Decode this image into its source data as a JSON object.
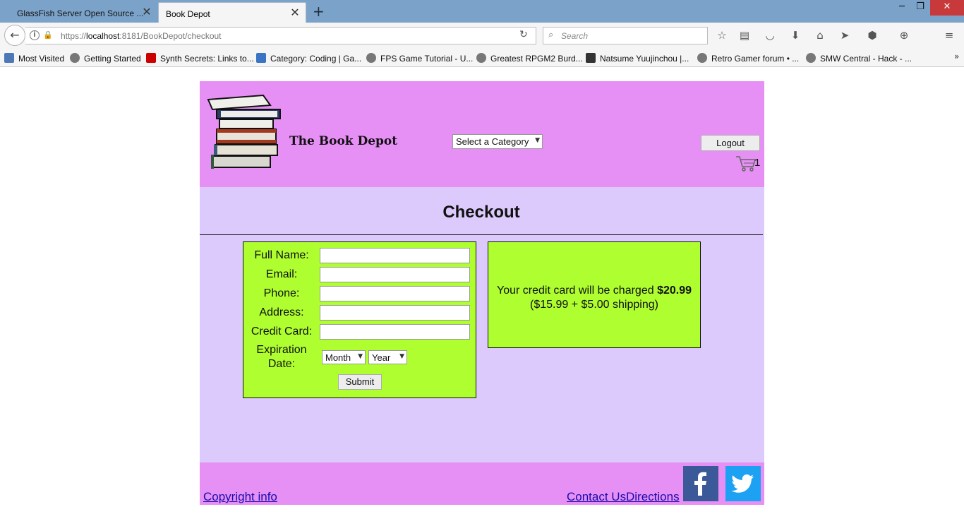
{
  "browser": {
    "tabs": [
      {
        "title": "GlassFish Server Open Source ...",
        "active": false
      },
      {
        "title": "Book Depot",
        "active": true
      }
    ],
    "url": {
      "scheme": "https://",
      "host": "localhost",
      "rest": ":8181/BookDepot/checkout"
    },
    "search_placeholder": "Search",
    "bookmarks": [
      {
        "label": "Most Visited",
        "icon": "bookmark-star-icon"
      },
      {
        "label": "Getting Started",
        "icon": "globe-icon"
      },
      {
        "label": "Synth Secrets: Links to...",
        "icon": "sos-icon"
      },
      {
        "label": "Category: Coding | Ga...",
        "icon": "wix-icon"
      },
      {
        "label": "FPS Game Tutorial - U...",
        "icon": "globe-icon"
      },
      {
        "label": "Greatest RPGM2 Burd...",
        "icon": "globe-icon"
      },
      {
        "label": "Natsume Yuujinchou |...",
        "icon": "ap-icon"
      },
      {
        "label": "Retro Gamer forum • ...",
        "icon": "globe-icon"
      },
      {
        "label": "SMW Central - Hack - ...",
        "icon": "globe-icon"
      }
    ]
  },
  "header": {
    "site_title": "The Book Depot",
    "category_select": "Select a Category",
    "logout_label": "Logout",
    "cart_count": "1"
  },
  "main": {
    "title": "Checkout",
    "form": {
      "fields": [
        {
          "label": "Full Name:",
          "value": ""
        },
        {
          "label": "Email:",
          "value": ""
        },
        {
          "label": "Phone:",
          "value": ""
        },
        {
          "label": "Address:",
          "value": ""
        },
        {
          "label": "Credit Card:",
          "value": ""
        }
      ],
      "expiration_label_1": "Expiration",
      "expiration_label_2": "Date:",
      "month_select": "Month",
      "year_select": "Year",
      "submit_label": "Submit"
    },
    "charge": {
      "text": "Your credit card will be charged",
      "amount": "$20.99",
      "breakdown": "($15.99 + $5.00 shipping)"
    }
  },
  "footer": {
    "copyright": "Copyright info",
    "contact": "Contact Us",
    "directions": "Directions"
  },
  "colors": {
    "header_bg": "#e68ff5",
    "main_bg": "#dccafc",
    "box_bg": "#aefe30",
    "link": "#1a0dab"
  }
}
